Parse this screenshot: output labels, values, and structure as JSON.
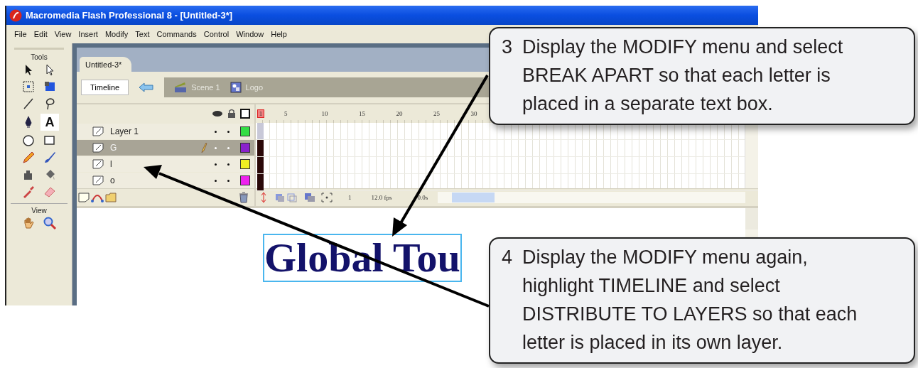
{
  "window": {
    "title": "Macromedia Flash Professional 8 - [Untitled-3*]"
  },
  "menu": [
    "File",
    "Edit",
    "View",
    "Insert",
    "Modify",
    "Text",
    "Commands",
    "Control",
    "Window",
    "Help"
  ],
  "tools": {
    "title": "Tools",
    "text_tool": "A",
    "view_title": "View"
  },
  "document_tab": {
    "label": "Untitled-3*",
    "selected": true
  },
  "edit_bar": {
    "timeline_button": "Timeline",
    "breadcrumbs": [
      "Scene 1",
      "Logo"
    ]
  },
  "timeline": {
    "frame_numbers": [
      "1",
      "5",
      "10",
      "15",
      "20",
      "25",
      "30"
    ],
    "layers": [
      {
        "name": "Layer 1",
        "selected": false,
        "color": "#33dd44"
      },
      {
        "name": "G",
        "selected": true,
        "color": "#8a22cc"
      },
      {
        "name": "l",
        "selected": false,
        "color": "#eeee22"
      },
      {
        "name": "o",
        "selected": false,
        "color": "#ee22ee"
      }
    ],
    "current_frame": "1",
    "frame_rate": "12.0 fps",
    "elapsed": "0.0s"
  },
  "stage": {
    "text": "Global Tou"
  },
  "callouts": [
    {
      "number": "3",
      "text": "Display the MODIFY menu and select BREAK APART so that each letter is placed in a separate text box."
    },
    {
      "number": "4",
      "text": "Display the MODIFY menu again, highlight TIMELINE and select DISTRIBUTE TO LAYERS so that each letter is placed in its own layer."
    }
  ]
}
